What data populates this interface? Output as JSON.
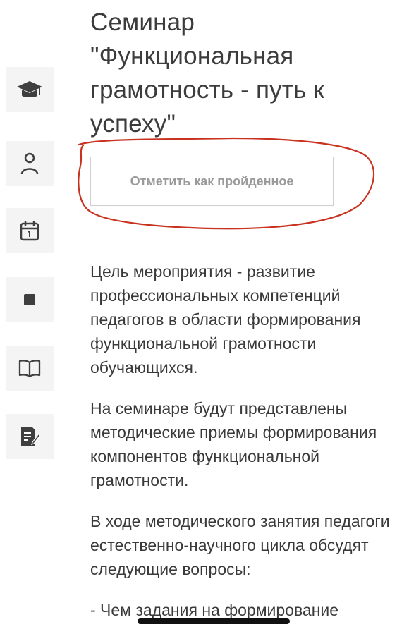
{
  "lesson": {
    "title": "Семинар \"Функциональная грамотность - путь к успеху\"",
    "complete_button_label": "Отметить как пройденное"
  },
  "sidebar": {
    "items": [
      {
        "icon": "graduation-cap-icon"
      },
      {
        "icon": "user-icon"
      },
      {
        "icon": "calendar-icon"
      },
      {
        "icon": "square-icon"
      },
      {
        "icon": "book-icon"
      },
      {
        "icon": "notes-edit-icon"
      }
    ]
  },
  "content": {
    "paragraphs": [
      "Цель мероприятия - развитие профессиональных компетенций педагогов в области формирования\n функциональной грамотности обучающихся.",
      "На семинаре будут представлены методические приемы формирования  компонентов функциональной грамотности.",
      "В ходе методического занятия педагоги естественно-научного цикла обсудят следующие вопросы:",
      "- Чем задания на формирование"
    ]
  },
  "colors": {
    "annotation_red": "#c8321e",
    "text": "#3a3a3a",
    "icon": "#3f3f3f"
  }
}
